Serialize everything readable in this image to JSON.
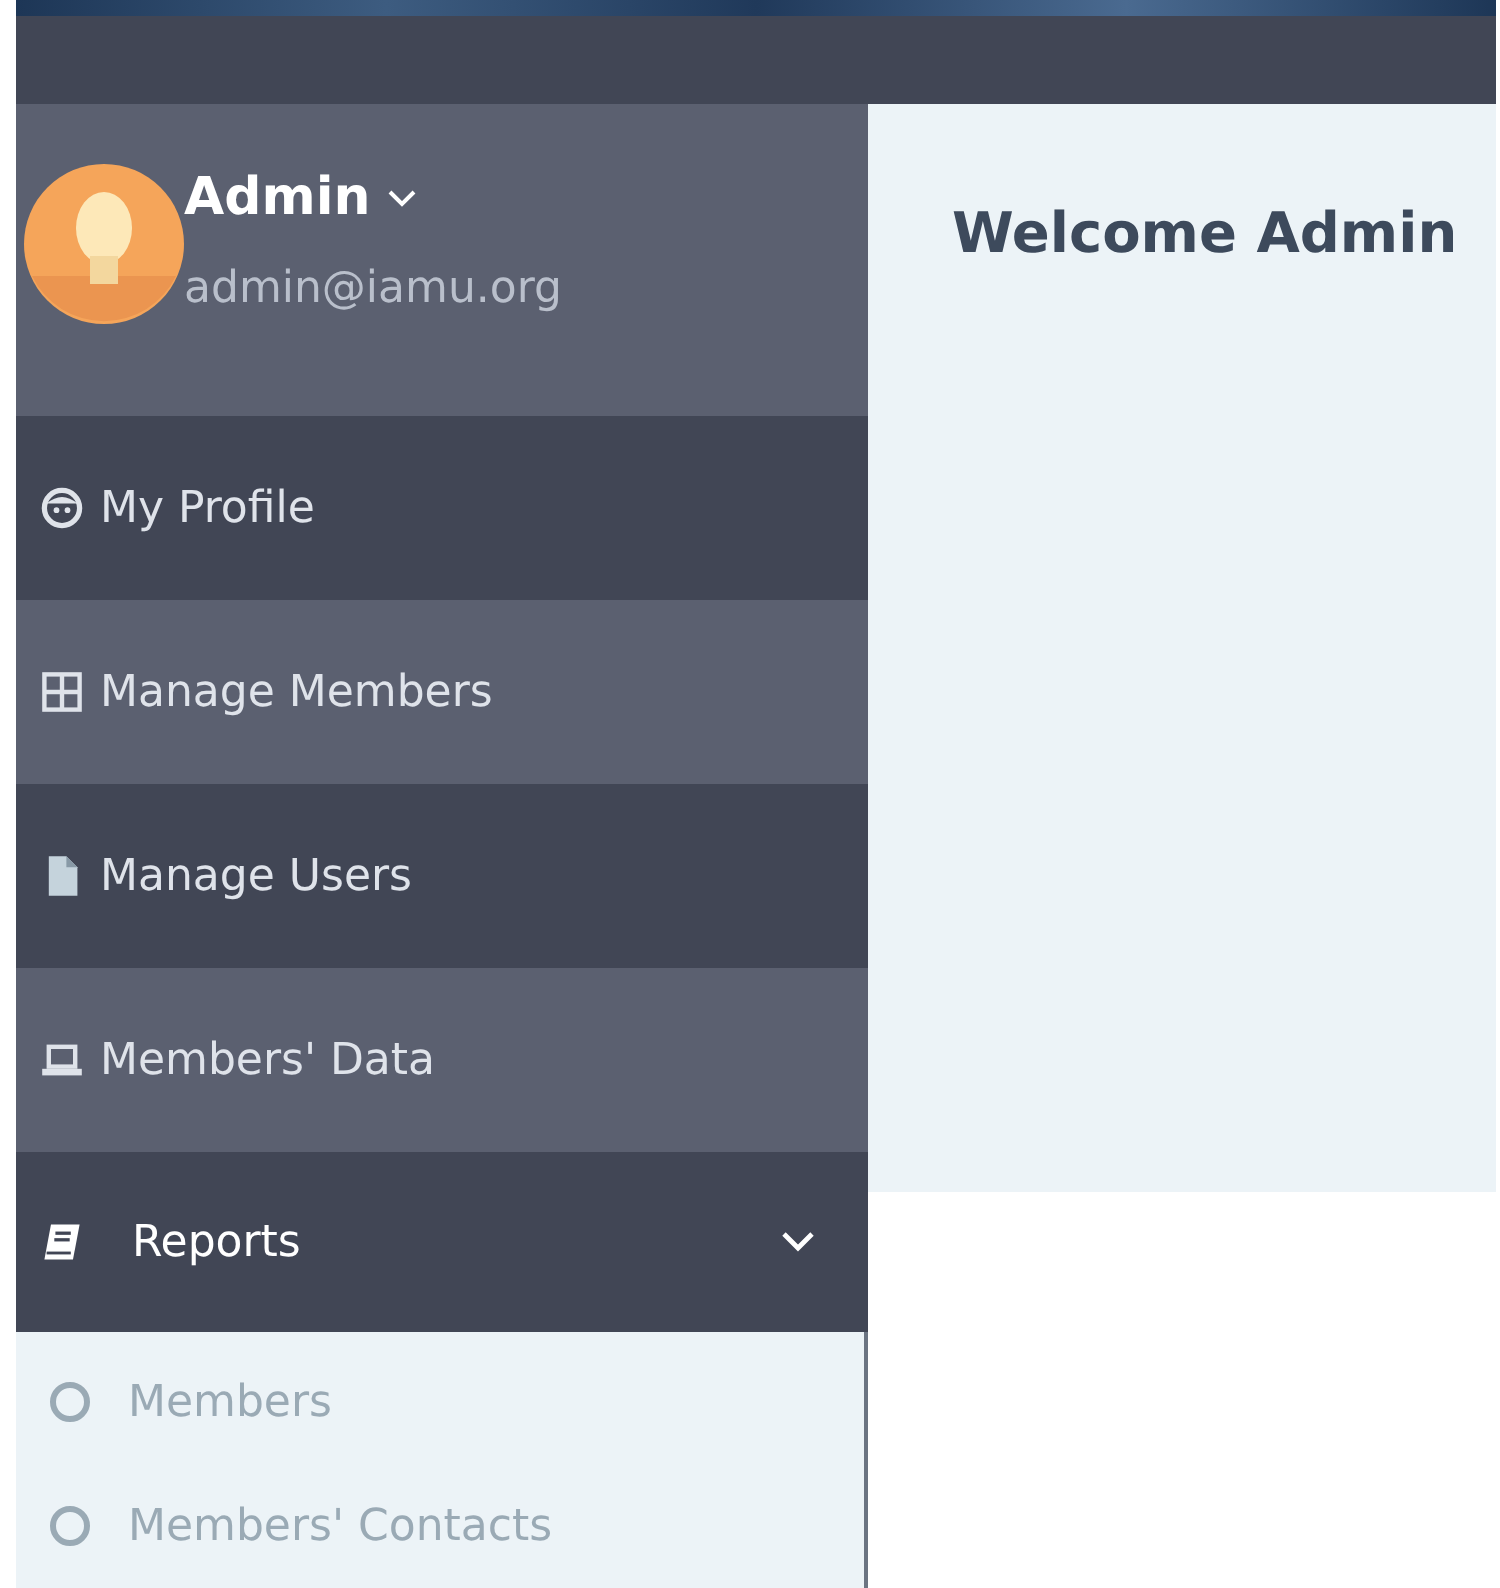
{
  "user": {
    "name": "Admin",
    "email": "admin@iamu.org"
  },
  "sidebar": {
    "items": [
      {
        "label": "My Profile",
        "kind": "profile"
      },
      {
        "label": "Manage Members",
        "kind": "grid"
      },
      {
        "label": "Manage Users",
        "kind": "file"
      },
      {
        "label": "Members' Data",
        "kind": "laptop"
      },
      {
        "label": "Reports",
        "kind": "book",
        "expanded": true,
        "children": [
          {
            "label": "Members"
          },
          {
            "label": "Members' Contacts"
          }
        ]
      }
    ]
  },
  "main": {
    "heading": "Welcome Admin"
  }
}
